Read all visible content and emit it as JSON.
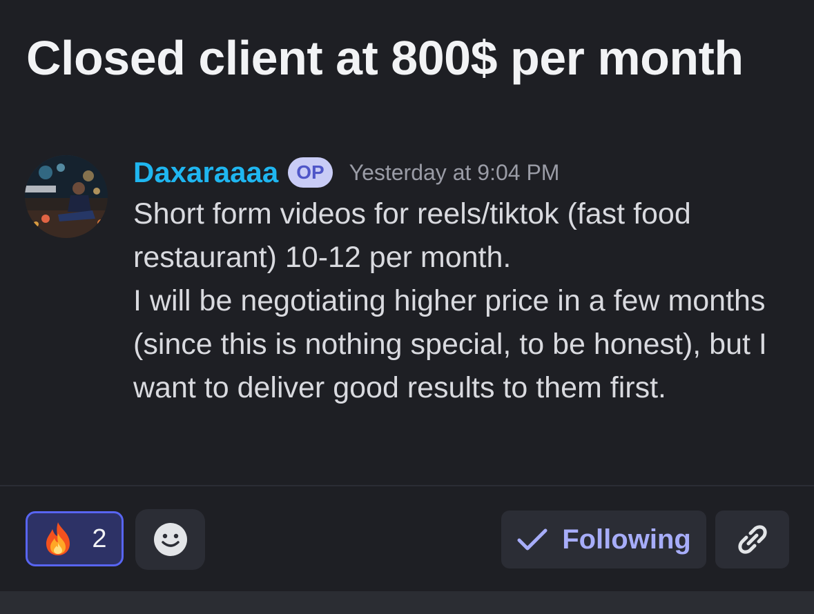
{
  "post": {
    "title": "Closed client at 800$ per month"
  },
  "message": {
    "author": "Daxaraaaa",
    "badge": "OP",
    "timestamp": "Yesterday at 9:04 PM",
    "paragraphs": [
      "Short form videos for reels/tiktok (fast food restaurant) 10-12 per month.",
      "I will be negotiating higher price in a few months  (since this is nothing special, to be honest), but I want to deliver good results to them first."
    ]
  },
  "reactions": {
    "items": [
      {
        "emoji": "fire",
        "count": "2"
      }
    ],
    "add_icon": "smiley-face-icon"
  },
  "actions": {
    "following_label": "Following",
    "following_icon": "checkmark-icon",
    "link_icon": "link-icon"
  },
  "colors": {
    "background": "#1e1f24",
    "author": "#1fb6f0",
    "accent": "#5865f2",
    "following_text": "#a7adf9"
  }
}
